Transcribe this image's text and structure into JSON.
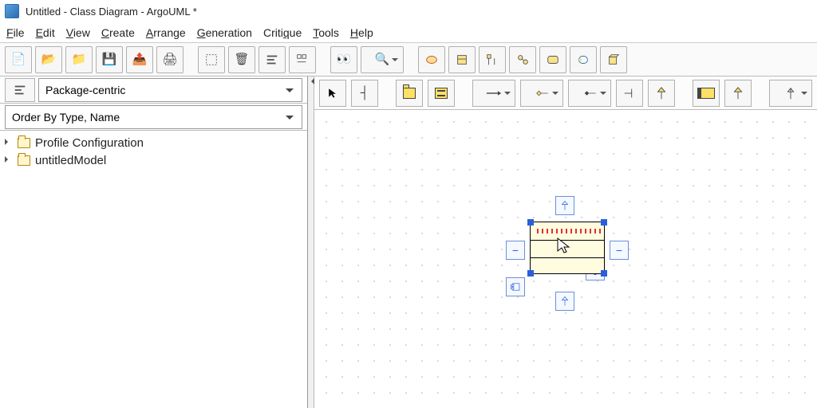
{
  "window": {
    "title": "Untitled - Class Diagram - ArgoUML *"
  },
  "menu": {
    "file": "File",
    "edit": "Edit",
    "view": "View",
    "create": "Create",
    "arrange": "Arrange",
    "generation": "Generation",
    "critique": "Critique",
    "tools": "Tools",
    "help": "Help"
  },
  "toolbar": {
    "new": "New",
    "open": "Open",
    "import": "Import",
    "save": "Save",
    "saveas": "Save As",
    "print": "Print",
    "select": "Select",
    "delete": "Delete",
    "align": "Align",
    "options": "Options",
    "find": "Find",
    "zoom": "Zoom",
    "diag_usecase": "Use Case",
    "diag_class": "Class",
    "diag_seq": "Sequence",
    "diag_collab": "Collaboration",
    "diag_state": "State",
    "diag_activity": "Activity",
    "diag_deploy": "Deployment"
  },
  "explorer": {
    "perspective_align_btn": "Align",
    "perspective": "Package-centric",
    "order": "Order By Type, Name",
    "tree": [
      {
        "label": "Profile Configuration"
      },
      {
        "label": "untitledModel"
      }
    ]
  },
  "palette": {
    "select": "Select",
    "broom": "Broom",
    "package": "Package",
    "class": "Class",
    "assoc": "Association",
    "dep": "Dependency",
    "comp": "Composition",
    "realize": "Realization",
    "general": "Generalization",
    "note": "Note",
    "general2": "Generalization",
    "up": "Generalization"
  },
  "canvas": {
    "element": {
      "type": "class",
      "selected": true,
      "name": ""
    }
  }
}
